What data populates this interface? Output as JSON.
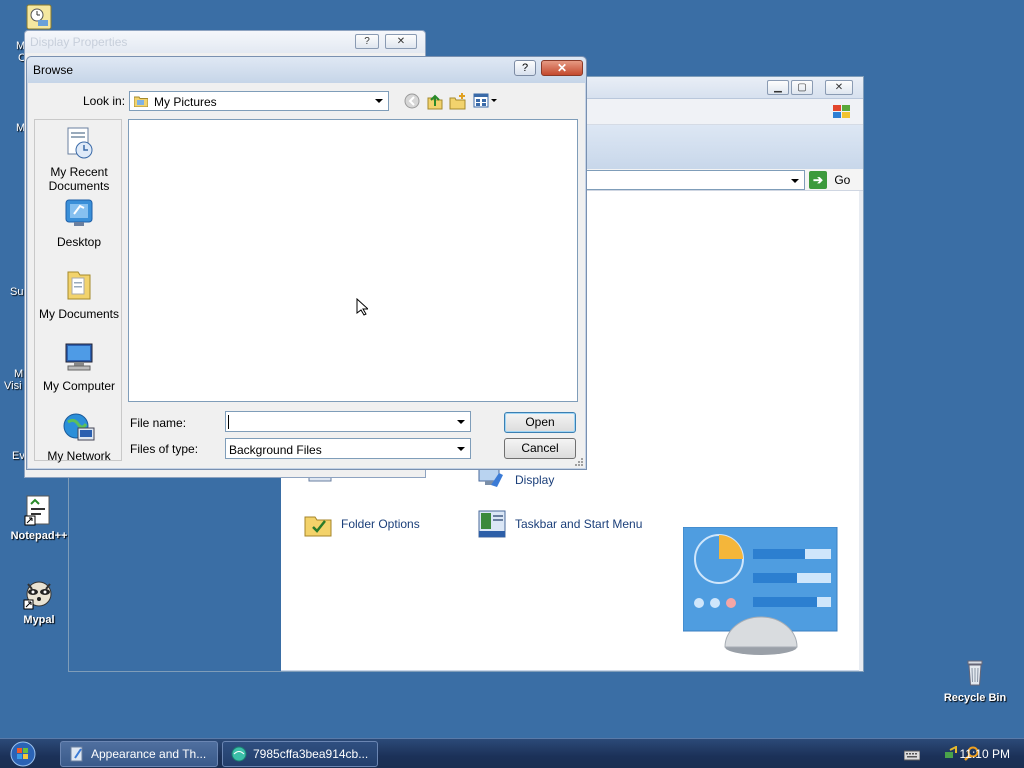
{
  "desktop": {
    "icons": [
      {
        "label": "Notepad++"
      },
      {
        "label": "Mypal"
      },
      {
        "label": "Recycle Bin"
      }
    ],
    "edge_fragments": [
      "M",
      "C",
      "M",
      "Su",
      "M",
      "Visi",
      "Ev"
    ]
  },
  "control_panel": {
    "go_label": "Go",
    "items": [
      {
        "label": "Display"
      },
      {
        "label": "Folder Options"
      },
      {
        "label": "Taskbar and Start Menu"
      }
    ]
  },
  "display_properties": {
    "title": "Display Properties",
    "help_label": "?",
    "close_label": "✕"
  },
  "browse": {
    "title": "Browse",
    "help_label": "?",
    "close_label": "✕",
    "look_in_label": "Look in:",
    "look_in_value": "My Pictures",
    "places": [
      {
        "label": "My Recent Documents",
        "icon": "recent-documents-icon"
      },
      {
        "label": "Desktop",
        "icon": "desktop-icon"
      },
      {
        "label": "My Documents",
        "icon": "my-documents-icon"
      },
      {
        "label": "My Computer",
        "icon": "my-computer-icon"
      },
      {
        "label": "My Network",
        "icon": "my-network-icon"
      }
    ],
    "file_name_label": "File name:",
    "file_name_value": "",
    "files_of_type_label": "Files of type:",
    "files_of_type_value": "Background Files",
    "open_label": "Open",
    "cancel_label": "Cancel"
  },
  "taskbar": {
    "buttons": [
      {
        "label": "Appearance and Th...",
        "active": true
      },
      {
        "label": "7985cffa3bea914cb...",
        "active": false
      }
    ],
    "clock": "11:10 PM"
  },
  "colors": {
    "desktop": "#3a6ea5",
    "dialog": "#f0f0f0",
    "close_red": "#c44a2e",
    "link_blue": "#1b3f7a"
  }
}
